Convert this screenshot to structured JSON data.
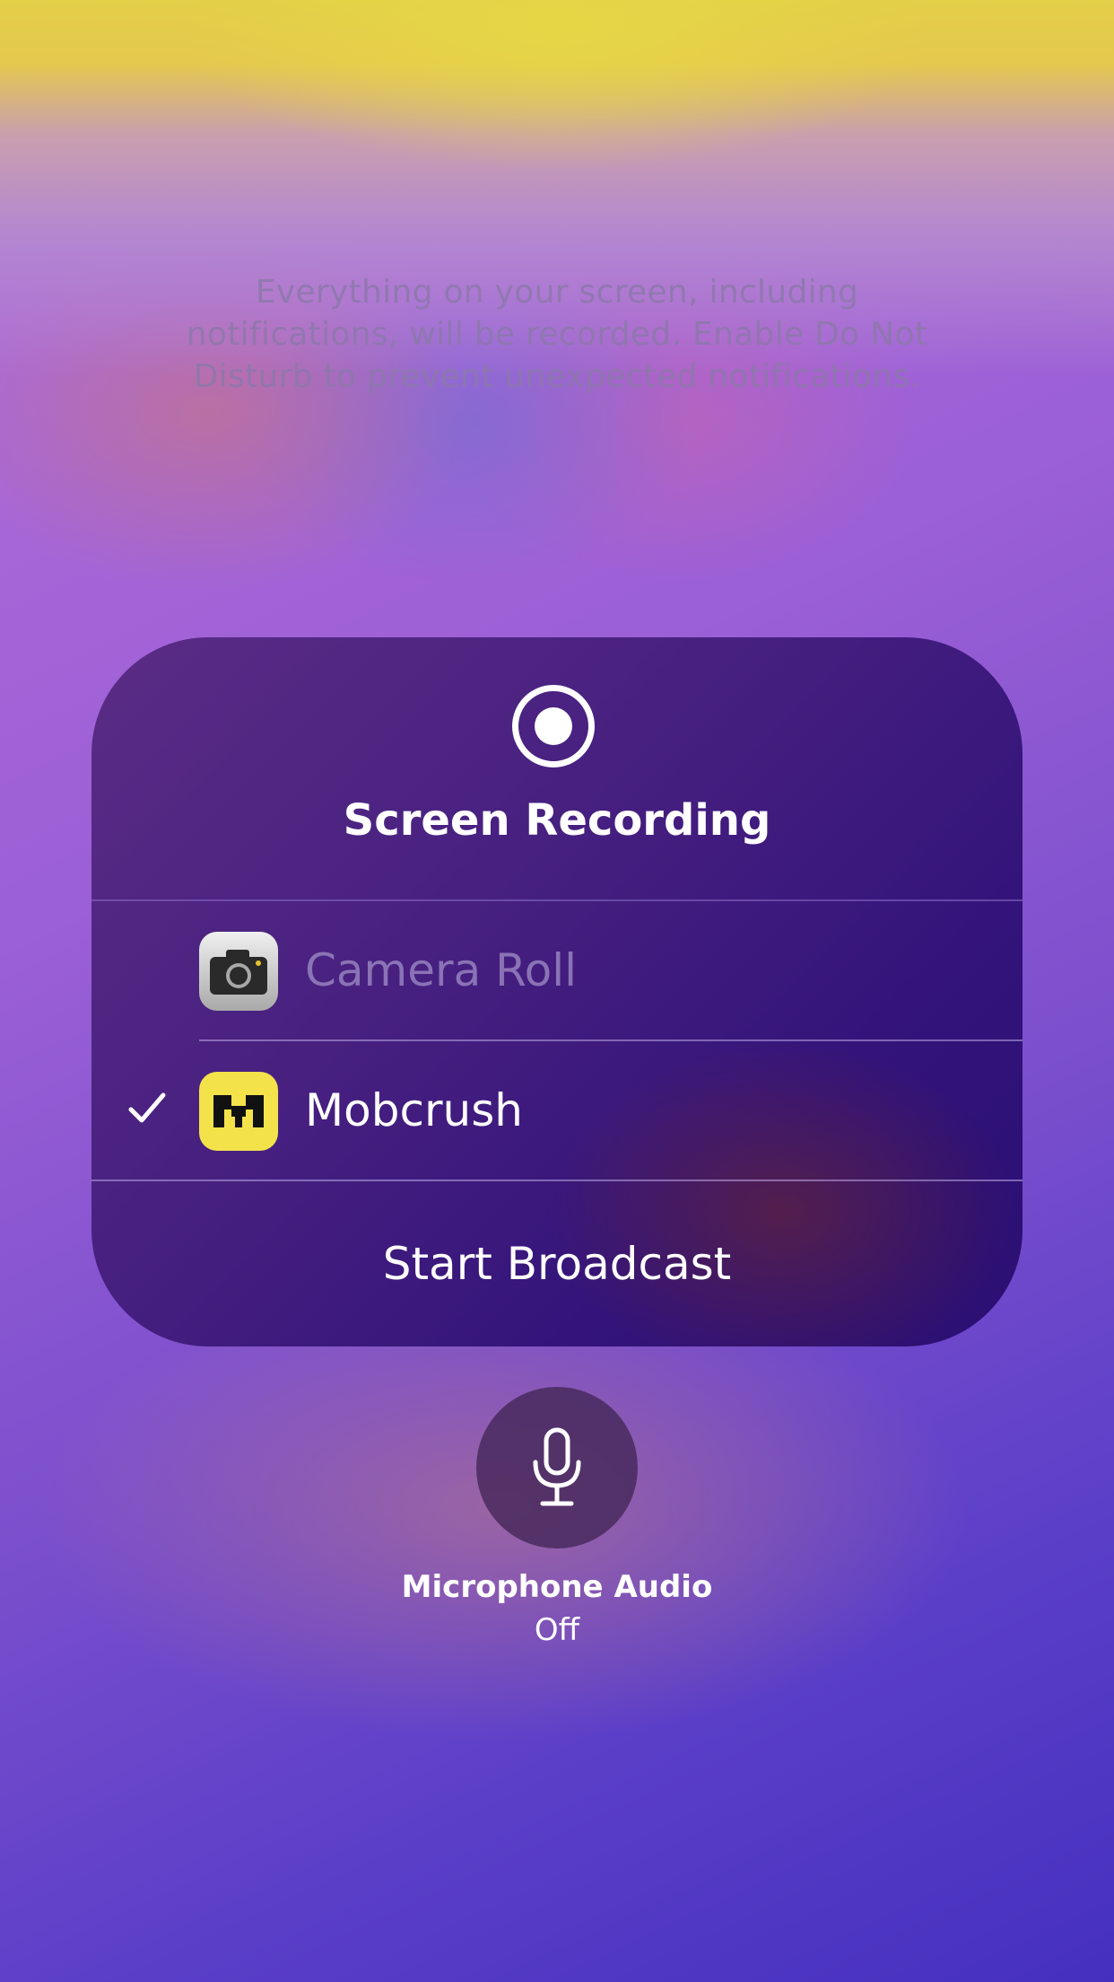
{
  "hint_text": "Everything on your screen, including notifications, will be recorded. Enable Do Not Disturb to prevent unexpected notifications.",
  "panel": {
    "title": "Screen Recording",
    "record_icon": "record-icon",
    "destinations": [
      {
        "label": "Camera Roll",
        "icon": "camera-icon",
        "selected": false
      },
      {
        "label": "Mobcrush",
        "icon": "mobcrush-icon",
        "selected": true
      }
    ],
    "action_label": "Start Broadcast"
  },
  "microphone": {
    "icon": "microphone-icon",
    "label": "Microphone Audio",
    "state": "Off"
  },
  "colors": {
    "card": "#3a1878",
    "mobcrush_yellow": "#f4e24b",
    "text": "#ffffff"
  }
}
